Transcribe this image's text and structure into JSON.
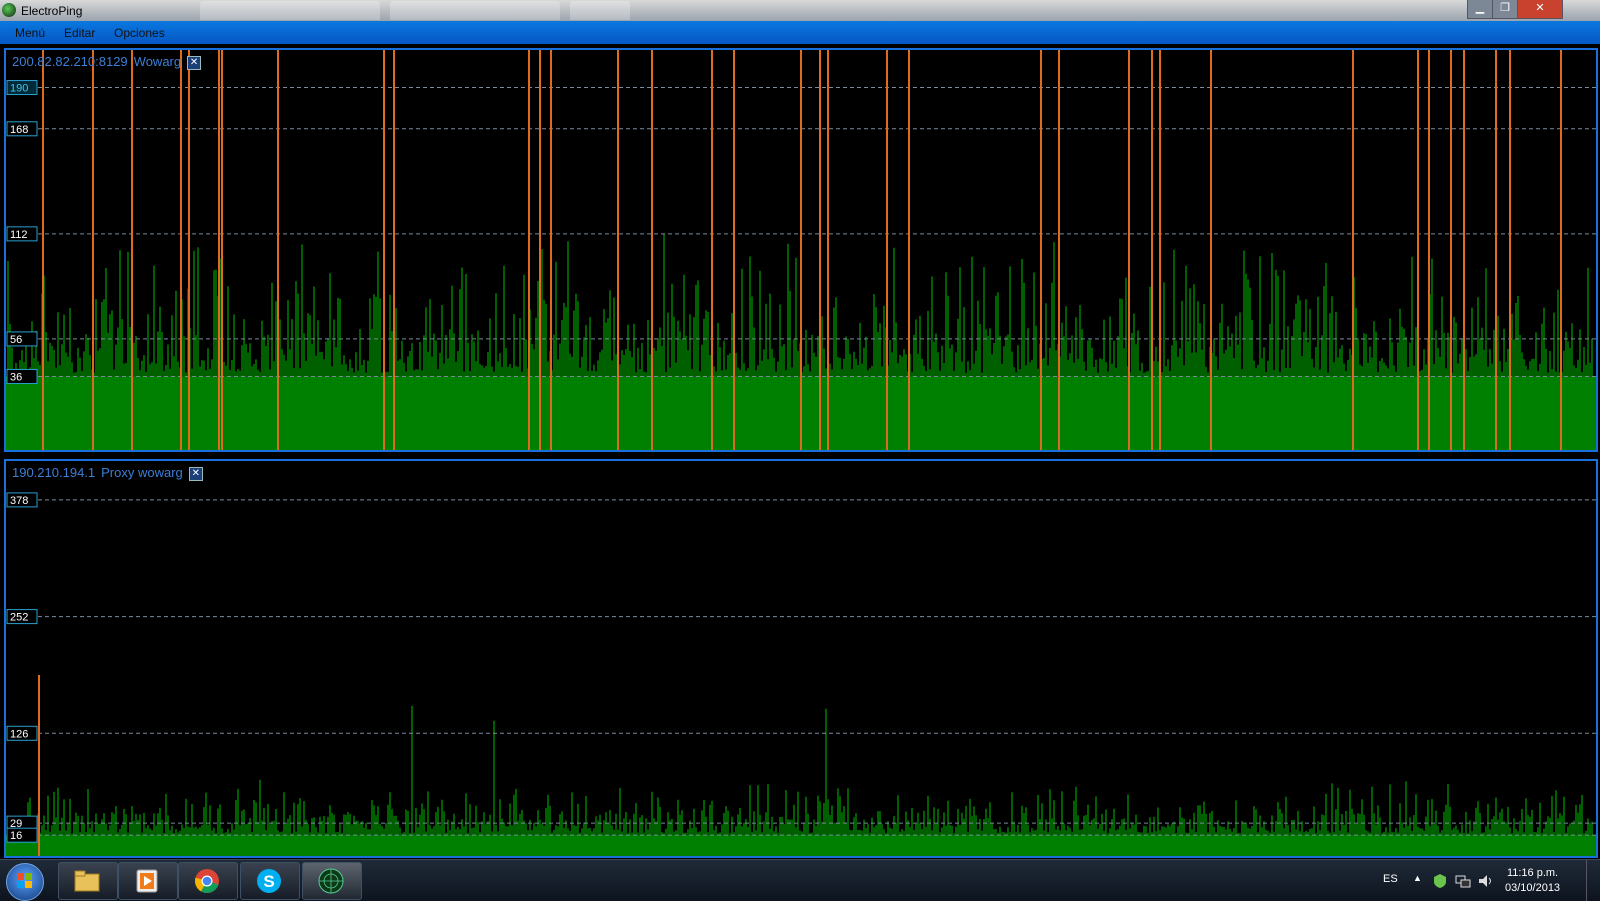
{
  "window": {
    "title": "ElectroPing"
  },
  "menu": {
    "items": [
      "Menú",
      "Editar",
      "Opciones"
    ]
  },
  "panels": [
    {
      "host": "200.82.82.210:8129",
      "name": "Wowarg",
      "close_glyph": "✕",
      "y_range": [
        0,
        210
      ],
      "gridlines": [
        190,
        168,
        112,
        56,
        36
      ],
      "baseline_ms": 36,
      "typical_ping_range_ms": [
        38,
        90
      ],
      "max_ping_ms": 115,
      "timeout_marker_fraction_x": [
        0.023,
        0.055,
        0.079,
        0.11,
        0.115,
        0.134,
        0.136,
        0.171,
        0.238,
        0.244,
        0.329,
        0.336,
        0.343,
        0.385,
        0.406,
        0.444,
        0.458,
        0.5,
        0.512,
        0.517,
        0.554,
        0.568,
        0.651,
        0.662,
        0.706,
        0.721,
        0.726,
        0.758,
        0.847,
        0.888,
        0.895,
        0.909,
        0.917,
        0.937,
        0.946,
        0.978
      ]
    },
    {
      "host": "190.210.194.1",
      "name": "Proxy wowarg",
      "close_glyph": "✕",
      "y_range": [
        0,
        420
      ],
      "gridlines": [
        378,
        252,
        126,
        29,
        16
      ],
      "baseline_ms": 16,
      "typical_ping_range_ms": [
        18,
        60
      ],
      "max_ping_ms": 160,
      "timeout_marker_fraction_x": [
        0.021
      ]
    }
  ],
  "colors": {
    "ping_bar": "#008000",
    "timeout_marker": "#e06a1e",
    "label_text": "#3b7fd6",
    "gridline": "#7a8a9a",
    "label_border": "#2aa0d0"
  },
  "taskbar": {
    "apps": [
      {
        "name": "file-explorer"
      },
      {
        "name": "media-player"
      },
      {
        "name": "chrome"
      },
      {
        "name": "skype"
      },
      {
        "name": "electroping"
      }
    ],
    "language": "ES",
    "time": "11:16 p.m.",
    "date": "03/10/2013"
  }
}
